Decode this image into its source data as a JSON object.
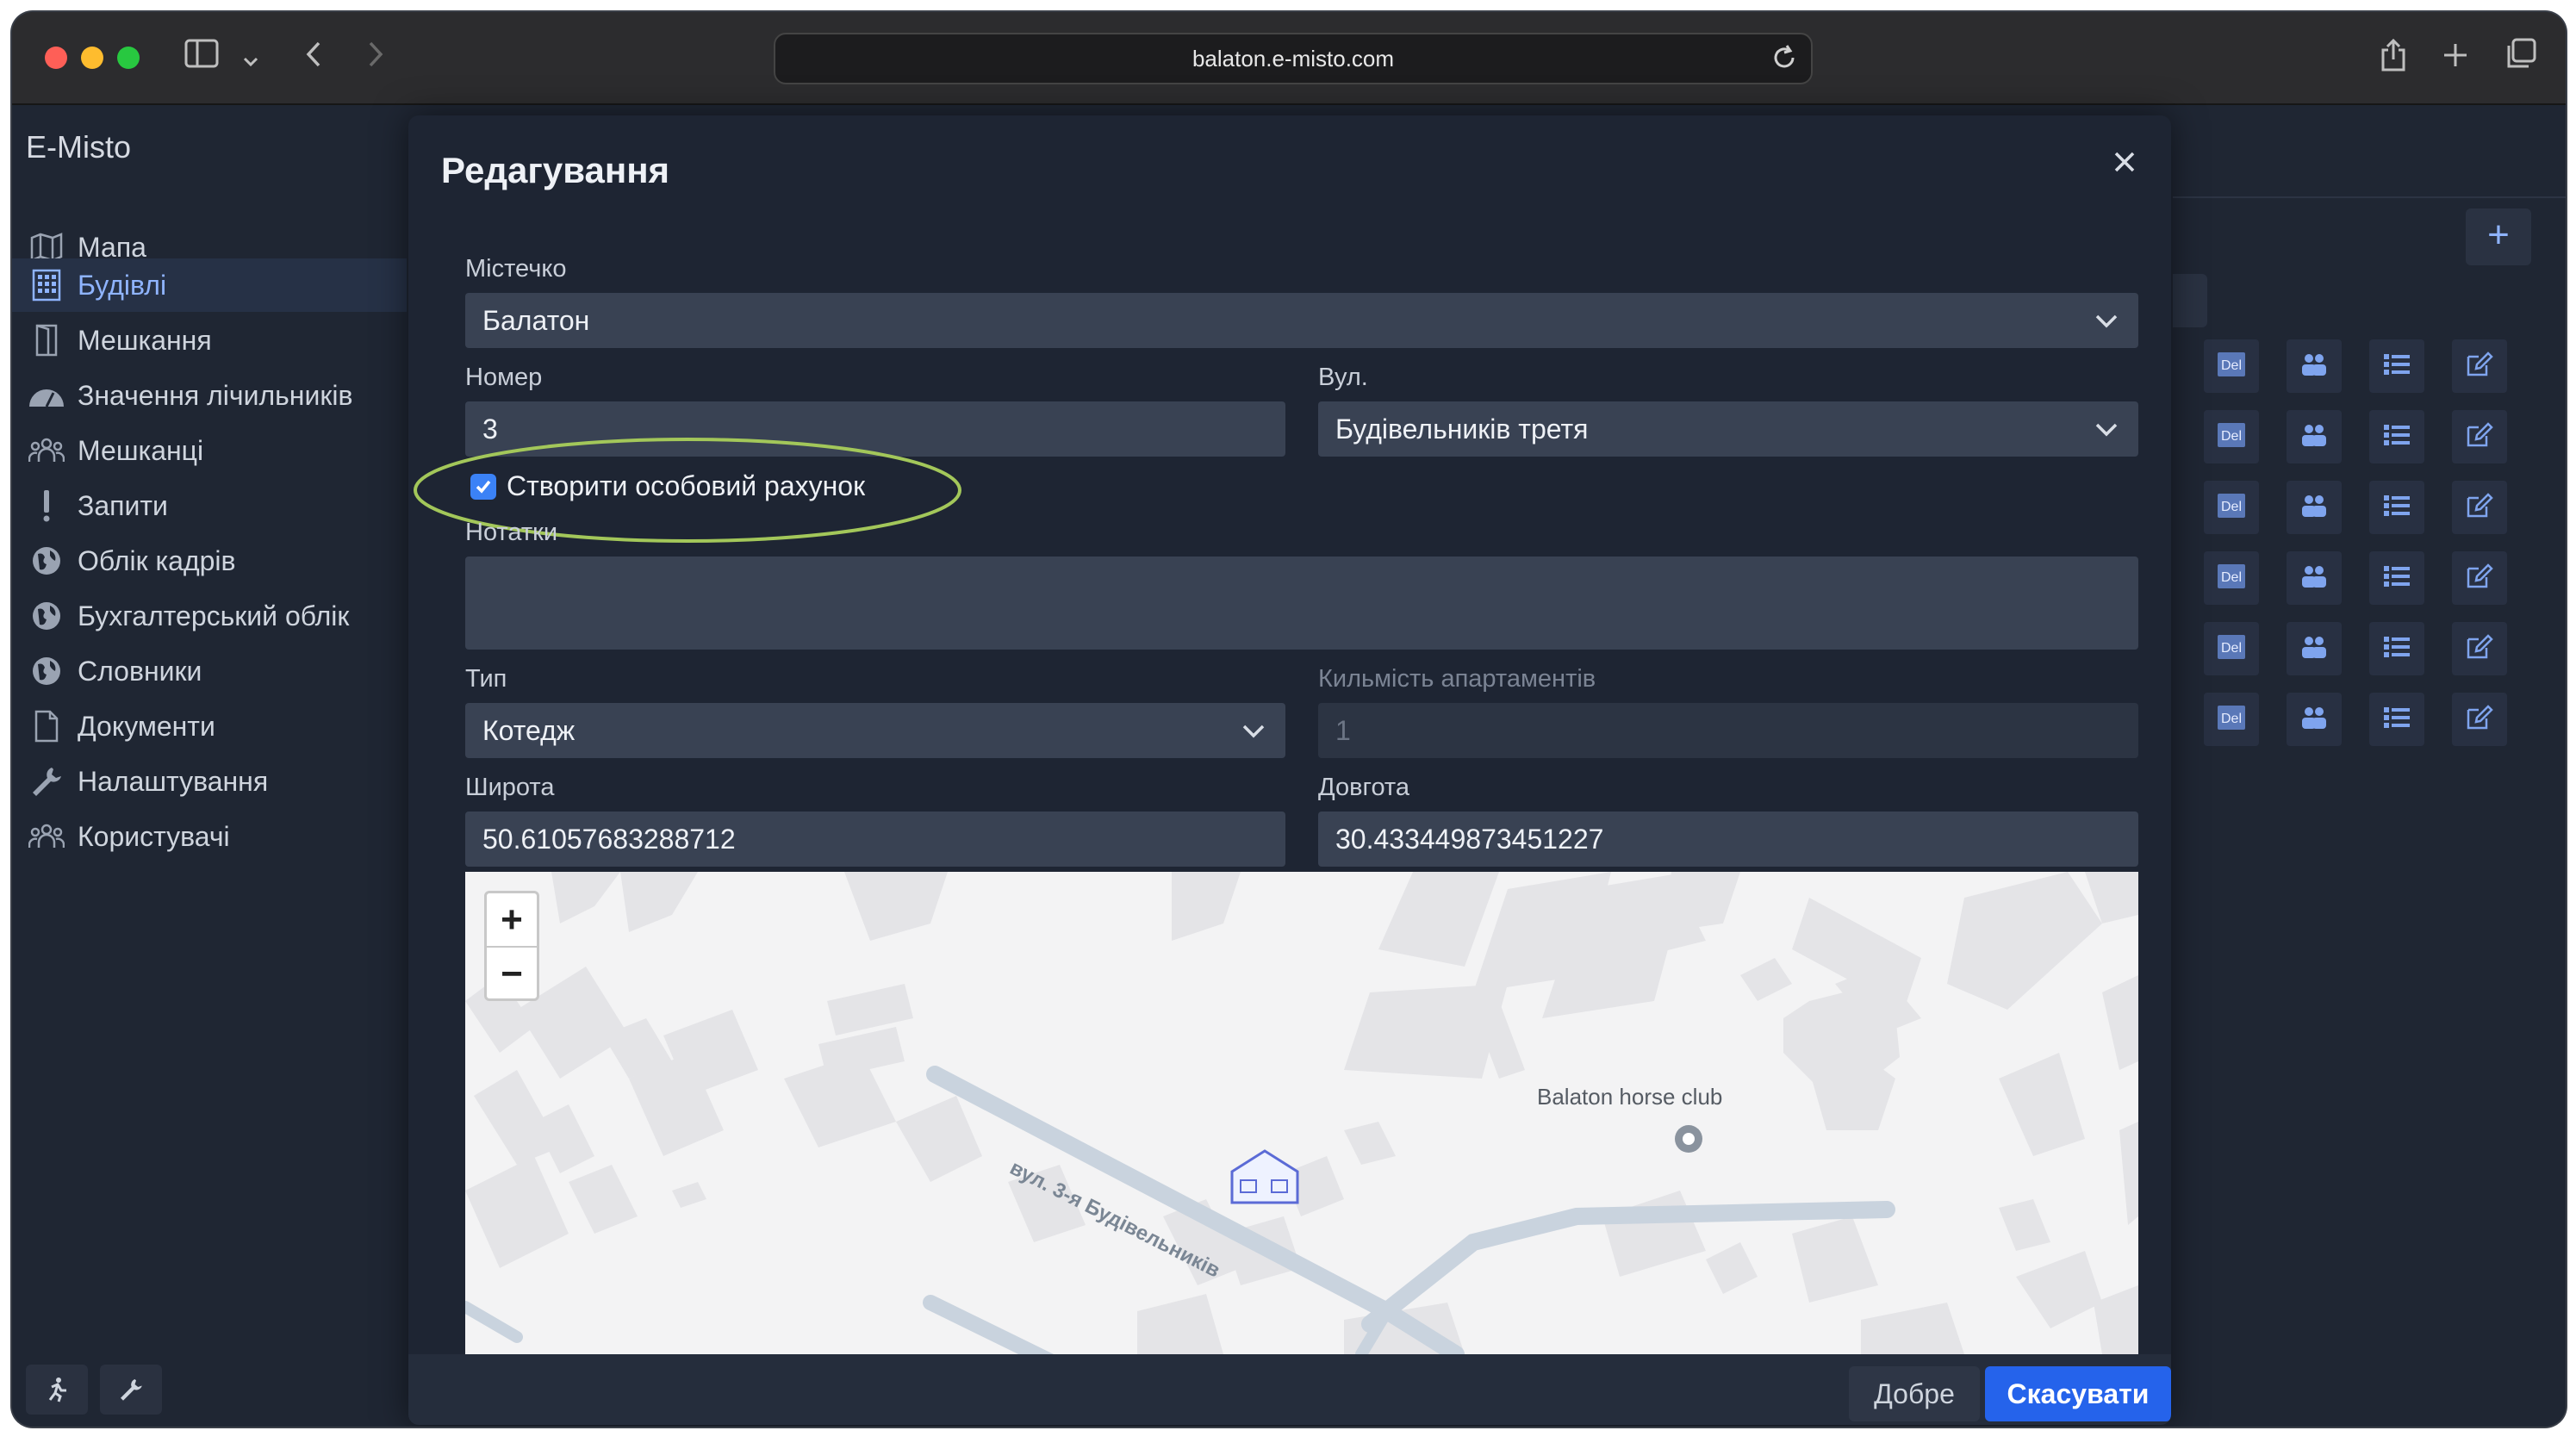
{
  "browser": {
    "url": "balaton.e-misto.com"
  },
  "app": {
    "title": "E-Misto"
  },
  "sidebar": {
    "items": [
      {
        "label": "Мапа",
        "icon": "map-icon"
      },
      {
        "label": "Будівлі",
        "icon": "building-icon",
        "active": true
      },
      {
        "label": "Мешкання",
        "icon": "door-icon"
      },
      {
        "label": "Значення лічильників",
        "icon": "gauge-icon"
      },
      {
        "label": "Мешканці",
        "icon": "people-icon"
      },
      {
        "label": "Запити",
        "icon": "exclamation-icon"
      },
      {
        "label": "Облік кадрів",
        "icon": "globe-icon"
      },
      {
        "label": "Бухгалтерський облік",
        "icon": "globe-icon"
      },
      {
        "label": "Словники",
        "icon": "globe-icon"
      },
      {
        "label": "Документи",
        "icon": "document-icon"
      },
      {
        "label": "Налаштування",
        "icon": "wrench-icon"
      },
      {
        "label": "Користувачі",
        "icon": "people-icon"
      }
    ]
  },
  "background_table": {
    "row_action_icons": [
      "del-icon",
      "users-icon",
      "list-icon",
      "edit-icon"
    ],
    "row_count": 6
  },
  "modal": {
    "title": "Редагування",
    "fields": {
      "town": {
        "label": "Містечко",
        "value": "Балатон"
      },
      "number": {
        "label": "Номер",
        "value": "3"
      },
      "street": {
        "label": "Вул.",
        "value": "Будівельників третя"
      },
      "create_account": {
        "label": "Створити особовий рахунок",
        "checked": true
      },
      "notes": {
        "label": "Нотатки",
        "value": ""
      },
      "type": {
        "label": "Тип",
        "value": "Котедж"
      },
      "apartments": {
        "label": "Кильмість апартаментів",
        "value": "1"
      },
      "latitude": {
        "label": "Широта",
        "value": "50.61057683288712"
      },
      "longitude": {
        "label": "Довгота",
        "value": "30.433449873451227"
      }
    },
    "map": {
      "zoom_in": "+",
      "zoom_out": "−",
      "poi_label": "Balaton horse club",
      "street_label": "вул. 3-я Будівельників"
    },
    "buttons": {
      "ok": "Добре",
      "cancel": "Скасувати"
    }
  },
  "colors": {
    "accent": "#2563eb",
    "highlight": "#a3c75a"
  }
}
